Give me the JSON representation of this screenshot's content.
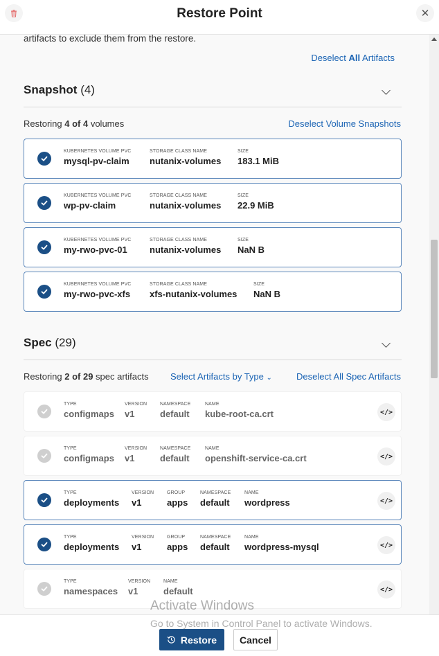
{
  "header": {
    "title": "Restore Point",
    "trash_icon": "trash-icon",
    "close_icon": "close-icon",
    "close_glyph": "✕"
  },
  "intro": {
    "text": "artifacts to exclude them from the restore.",
    "deselect_all_prefix": "Deselect ",
    "deselect_all_bold": "All",
    "deselect_all_suffix": " Artifacts"
  },
  "snapshot": {
    "title": "Snapshot",
    "count": "(4)",
    "status_prefix": "Restoring ",
    "status_bold": "4 of 4",
    "status_suffix": " volumes",
    "deselect_link": "Deselect Volume Snapshots",
    "items": [
      {
        "f1_label": "KUBERNETES VOLUME PVC",
        "f1_value": "mysql-pv-claim",
        "f2_label": "STORAGE CLASS NAME",
        "f2_value": "nutanix-volumes",
        "f3_label": "SIZE",
        "f3_value": "183.1 MiB"
      },
      {
        "f1_label": "KUBERNETES VOLUME PVC",
        "f1_value": "wp-pv-claim",
        "f2_label": "STORAGE CLASS NAME",
        "f2_value": "nutanix-volumes",
        "f3_label": "SIZE",
        "f3_value": "22.9 MiB"
      },
      {
        "f1_label": "KUBERNETES VOLUME PVC",
        "f1_value": "my-rwo-pvc-01",
        "f2_label": "STORAGE CLASS NAME",
        "f2_value": "nutanix-volumes",
        "f3_label": "SIZE",
        "f3_value": "NaN B"
      },
      {
        "f1_label": "KUBERNETES VOLUME PVC",
        "f1_value": "my-rwo-pvc-xfs",
        "f2_label": "STORAGE CLASS NAME",
        "f2_value": "xfs-nutanix-volumes",
        "f3_label": "SIZE",
        "f3_value": "NaN B"
      }
    ]
  },
  "spec": {
    "title": "Spec",
    "count": "(29)",
    "status_prefix": "Restoring ",
    "status_bold": "2 of 29",
    "status_suffix": " spec artifacts",
    "select_by_type": "Select Artifacts by Type",
    "deselect_link": "Deselect All Spec Artifacts",
    "items": [
      {
        "type_label": "TYPE",
        "type": "configmaps",
        "version_label": "VERSION",
        "version": "v1",
        "namespace_label": "NAMESPACE",
        "namespace": "default",
        "name_label": "NAME",
        "name": "kube-root-ca.crt"
      },
      {
        "type_label": "TYPE",
        "type": "configmaps",
        "version_label": "VERSION",
        "version": "v1",
        "namespace_label": "NAMESPACE",
        "namespace": "default",
        "name_label": "NAME",
        "name": "openshift-service-ca.crt"
      },
      {
        "type_label": "TYPE",
        "type": "deployments",
        "version_label": "VERSION",
        "version": "v1",
        "group_label": "GROUP",
        "group": "apps",
        "namespace_label": "NAMESPACE",
        "namespace": "default",
        "name_label": "NAME",
        "name": "wordpress"
      },
      {
        "type_label": "TYPE",
        "type": "deployments",
        "version_label": "VERSION",
        "version": "v1",
        "group_label": "GROUP",
        "group": "apps",
        "namespace_label": "NAMESPACE",
        "namespace": "default",
        "name_label": "NAME",
        "name": "wordpress-mysql"
      },
      {
        "type_label": "TYPE",
        "type": "namespaces",
        "version_label": "VERSION",
        "version": "v1",
        "name_label": "NAME",
        "name": "default"
      }
    ],
    "code_glyph": "</>"
  },
  "footer": {
    "restore_label": "Restore",
    "cancel_label": "Cancel"
  },
  "watermark": {
    "line1": "Activate Windows",
    "line2": "Go to System in Control Panel to activate Windows."
  },
  "colors": {
    "accent": "#1b4f86",
    "link": "#1b64b4",
    "selected_border": "#5b87bb"
  }
}
